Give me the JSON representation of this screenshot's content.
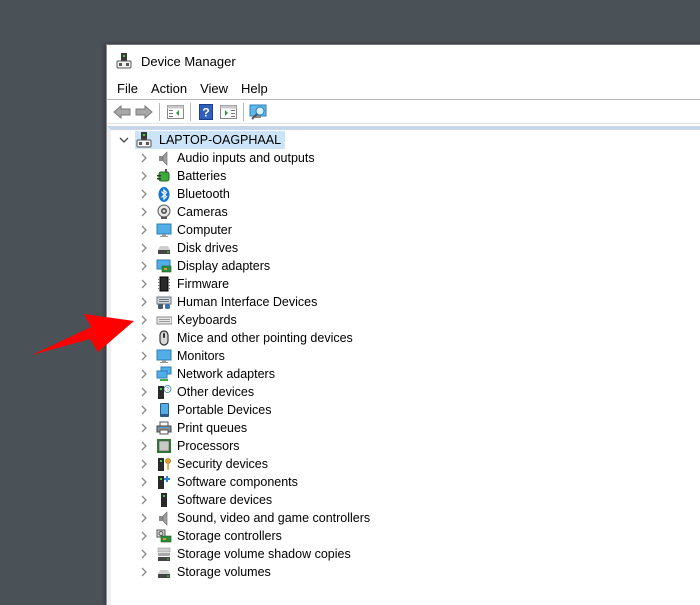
{
  "window": {
    "title": "Device Manager",
    "app_icon": "device-manager-icon"
  },
  "menubar": {
    "items": [
      "File",
      "Action",
      "View",
      "Help"
    ]
  },
  "toolbar": {
    "buttons": [
      {
        "name": "back-button",
        "icon": "arrow-left-icon"
      },
      {
        "name": "forward-button",
        "icon": "arrow-right-icon"
      },
      {
        "name": "show-hide-console-tree-button",
        "icon": "console-tree-icon"
      },
      {
        "name": "help-button",
        "icon": "help-icon"
      },
      {
        "name": "show-hide-action-pane-button",
        "icon": "action-pane-icon"
      },
      {
        "name": "scan-hardware-button",
        "icon": "scan-hardware-icon"
      }
    ]
  },
  "tree": {
    "root": {
      "label": "LAPTOP-OAGPHAAL",
      "expanded": true,
      "selected": true,
      "icon": "computer-tower-icon"
    },
    "items": [
      {
        "label": "Audio inputs and outputs",
        "icon": "speaker-icon"
      },
      {
        "label": "Batteries",
        "icon": "battery-icon"
      },
      {
        "label": "Bluetooth",
        "icon": "bluetooth-icon"
      },
      {
        "label": "Cameras",
        "icon": "camera-icon"
      },
      {
        "label": "Computer",
        "icon": "monitor-icon"
      },
      {
        "label": "Disk drives",
        "icon": "disk-drive-icon"
      },
      {
        "label": "Display adapters",
        "icon": "display-adapter-icon"
      },
      {
        "label": "Firmware",
        "icon": "chip-icon"
      },
      {
        "label": "Human Interface Devices",
        "icon": "hid-icon"
      },
      {
        "label": "Keyboards",
        "icon": "keyboard-icon"
      },
      {
        "label": "Mice and other pointing devices",
        "icon": "mouse-icon"
      },
      {
        "label": "Monitors",
        "icon": "monitor-icon"
      },
      {
        "label": "Network adapters",
        "icon": "network-icon"
      },
      {
        "label": "Other devices",
        "icon": "unknown-device-icon"
      },
      {
        "label": "Portable Devices",
        "icon": "portable-device-icon"
      },
      {
        "label": "Print queues",
        "icon": "printer-icon"
      },
      {
        "label": "Processors",
        "icon": "processor-icon"
      },
      {
        "label": "Security devices",
        "icon": "security-key-icon"
      },
      {
        "label": "Software components",
        "icon": "software-component-icon"
      },
      {
        "label": "Software devices",
        "icon": "software-device-icon"
      },
      {
        "label": "Sound, video and game controllers",
        "icon": "speaker-icon"
      },
      {
        "label": "Storage controllers",
        "icon": "storage-controller-icon"
      },
      {
        "label": "Storage volume shadow copies",
        "icon": "shadow-copy-icon"
      },
      {
        "label": "Storage volumes",
        "icon": "disk-drive-icon"
      }
    ]
  },
  "annotation": {
    "type": "red-arrow",
    "points_to": "Keyboards",
    "color": "#ff0000"
  },
  "colors": {
    "desktop": "#4a5157",
    "selection": "#cce4f7",
    "tree_top_border": "#c4d6e8"
  }
}
